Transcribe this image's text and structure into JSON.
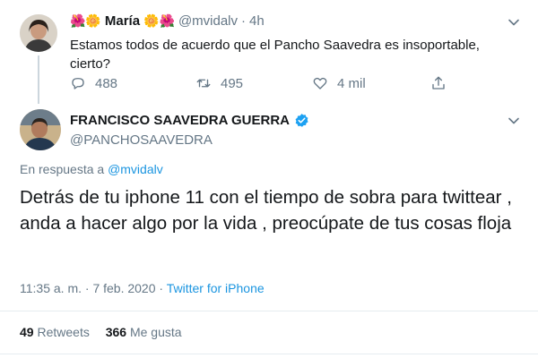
{
  "reply": {
    "name": "María",
    "handle": "@mvidalv",
    "dot": "·",
    "time": "4h",
    "text": "Estamos todos de acuerdo que el Pancho Saavedra es insoportable, cierto?",
    "actions": {
      "replies": "488",
      "retweets": "495",
      "likes": "4 mil"
    }
  },
  "tweet": {
    "name": "FRANCISCO SAAVEDRA GUERRA",
    "handle": "@PANCHOSAAVEDRA",
    "reply_to_prefix": "En respuesta a",
    "reply_to_handle": "@mvidalv",
    "text": "Detrás de tu iphone 11 con el tiempo de sobra para twittear , anda a hacer algo por la vida , preocúpate de tus cosas floja",
    "timestamp": "11:35 a. m. · 7 feb. 2020 ·",
    "source": "Twitter for iPhone",
    "retweets_count": "49",
    "retweets_label": "Retweets",
    "likes_count": "366",
    "likes_label": "Me gusta"
  },
  "colors": {
    "accent": "#1b95e0",
    "muted": "#657786",
    "verified": "#1da1f2"
  },
  "icons": [
    "flower-emoji-icon",
    "reply-icon",
    "retweet-icon",
    "like-icon",
    "share-icon",
    "verified-badge-icon",
    "chevron-down-icon"
  ]
}
